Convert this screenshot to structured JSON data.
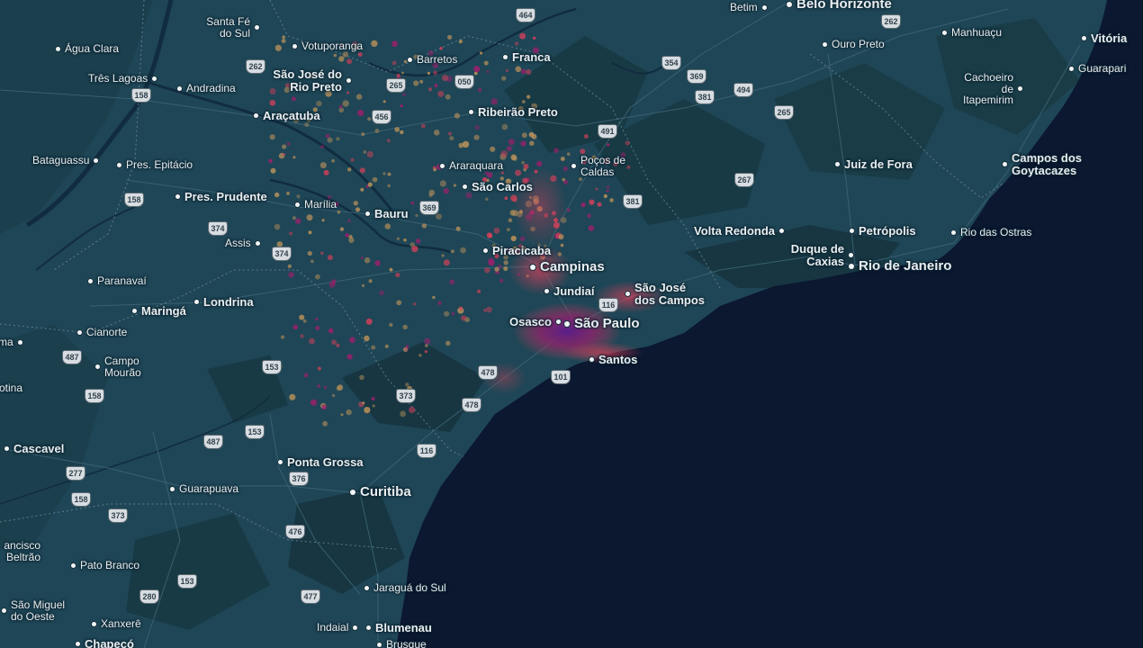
{
  "map": {
    "colors": {
      "land": "#1f4656",
      "land_dark": "#173642",
      "forest": "#183a45",
      "ocean": "#0b1830",
      "river": "#112c3f",
      "road": "#3c6474",
      "border": "#6d8a97",
      "heat_low": "#b7905a",
      "heat_mid": "#d4405a",
      "heat_high": "#9e1f6e",
      "heat_peak": "#5a1b8c"
    },
    "cities": [
      {
        "name": "Belo Horizonte",
        "tier": 1
      },
      {
        "name": "Betim",
        "tier": 3
      },
      {
        "name": "Vitória",
        "tier": 2
      },
      {
        "name": "Guarapari",
        "tier": 3
      },
      {
        "name": "Manhuaçu",
        "tier": 3
      },
      {
        "name": "Ouro Preto",
        "tier": 3
      },
      {
        "name": "Cachoeiro de Itapemirim",
        "tier": 3
      },
      {
        "name": "Campos dos Goytacazes",
        "tier": 2
      },
      {
        "name": "Juiz de Fora",
        "tier": 2
      },
      {
        "name": "Petrópolis",
        "tier": 2
      },
      {
        "name": "Volta Redonda",
        "tier": 2
      },
      {
        "name": "Duque de Caxias",
        "tier": 2
      },
      {
        "name": "Rio de Janeiro",
        "tier": 1
      },
      {
        "name": "Rio das Ostras",
        "tier": 3
      },
      {
        "name": "Santa Fé do Sul",
        "tier": 3
      },
      {
        "name": "Votuporanga",
        "tier": 3
      },
      {
        "name": "Barretos",
        "tier": 3
      },
      {
        "name": "Franca",
        "tier": 2
      },
      {
        "name": "Água Clara",
        "tier": 3
      },
      {
        "name": "Três Lagoas",
        "tier": 3
      },
      {
        "name": "Andradina",
        "tier": 3
      },
      {
        "name": "São José do Rio Preto",
        "tier": 2
      },
      {
        "name": "Araçatuba",
        "tier": 2
      },
      {
        "name": "Ribeirão Preto",
        "tier": 2
      },
      {
        "name": "Bataguassu",
        "tier": 3
      },
      {
        "name": "Pres. Epitácio",
        "tier": 3
      },
      {
        "name": "Araraquara",
        "tier": 3
      },
      {
        "name": "Poços de Caldas",
        "tier": 3
      },
      {
        "name": "São Carlos",
        "tier": 2
      },
      {
        "name": "Pres. Prudente",
        "tier": 2
      },
      {
        "name": "Marília",
        "tier": 3
      },
      {
        "name": "Bauru",
        "tier": 2
      },
      {
        "name": "Assis",
        "tier": 3
      },
      {
        "name": "Piracicaba",
        "tier": 2
      },
      {
        "name": "Campinas",
        "tier": 1
      },
      {
        "name": "Jundiaí",
        "tier": 2
      },
      {
        "name": "São José dos Campos",
        "tier": 2
      },
      {
        "name": "Osasco",
        "tier": 2
      },
      {
        "name": "São Paulo",
        "tier": 1
      },
      {
        "name": "Santos",
        "tier": 2
      },
      {
        "name": "Paranavaí",
        "tier": 3
      },
      {
        "name": "Londrina",
        "tier": 2
      },
      {
        "name": "Maringá",
        "tier": 2
      },
      {
        "name": "Cianorte",
        "tier": 3
      },
      {
        "name": "ma",
        "tier": 3
      },
      {
        "name": "Campo Mourão",
        "tier": 3
      },
      {
        "name": "otina",
        "tier": 3
      },
      {
        "name": "Cascavel",
        "tier": 2
      },
      {
        "name": "Ponta Grossa",
        "tier": 2
      },
      {
        "name": "Guarapuava",
        "tier": 3
      },
      {
        "name": "Curitiba",
        "tier": 1
      },
      {
        "name": "ancisco Beltrão",
        "tier": 3
      },
      {
        "name": "Pato Branco",
        "tier": 3
      },
      {
        "name": "Jaraguá do Sul",
        "tier": 3
      },
      {
        "name": "São Miguel do Oeste",
        "tier": 3
      },
      {
        "name": "Xanxerê",
        "tier": 3
      },
      {
        "name": "Indaial",
        "tier": 3
      },
      {
        "name": "Blumenau",
        "tier": 2
      },
      {
        "name": "Chapecó",
        "tier": 2
      },
      {
        "name": "Brusque",
        "tier": 3
      }
    ],
    "shields": [
      "464",
      "262",
      "354",
      "369",
      "381",
      "494",
      "265",
      "050",
      "262",
      "158",
      "265",
      "456",
      "491",
      "267",
      "381",
      "158",
      "369",
      "374",
      "374",
      "116",
      "487",
      "153",
      "158",
      "478",
      "478",
      "373",
      "101",
      "153",
      "487",
      "116",
      "277",
      "376",
      "158",
      "373",
      "476",
      "280",
      "153",
      "477"
    ]
  }
}
